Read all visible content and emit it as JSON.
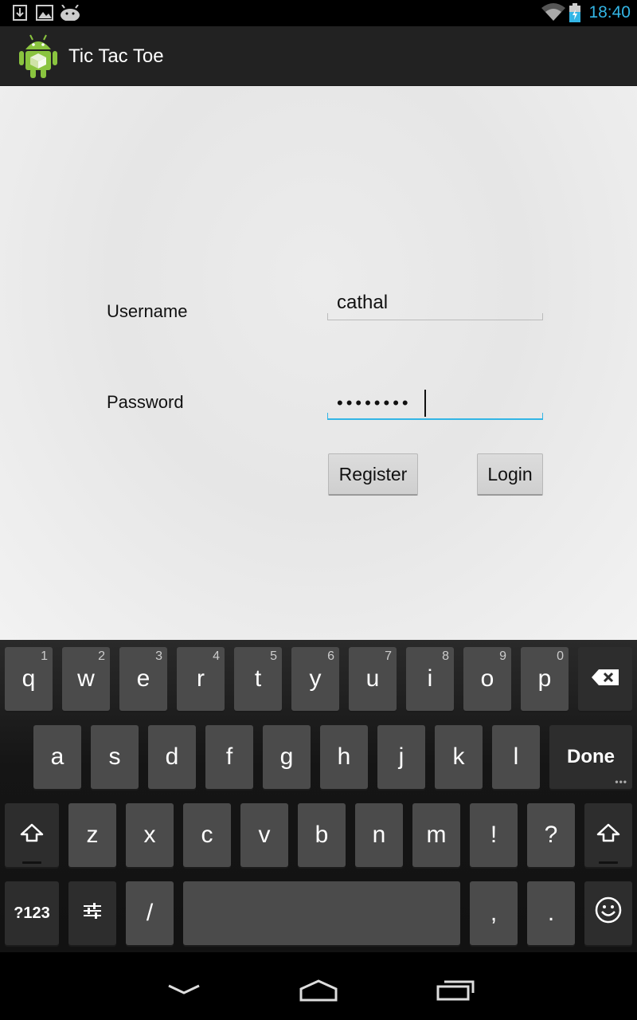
{
  "status_bar": {
    "time": "18:40",
    "left_icons": [
      "download-icon",
      "picture-icon",
      "android-debug-icon"
    ],
    "right_icons": [
      "wifi-icon",
      "battery-icon"
    ]
  },
  "action_bar": {
    "title": "Tic Tac Toe",
    "icon": "android-app-icon"
  },
  "form": {
    "username_label": "Username",
    "username_value": "cathal",
    "password_label": "Password",
    "password_masked": "••••••••",
    "register_label": "Register",
    "login_label": "Login"
  },
  "keyboard": {
    "row1": [
      {
        "label": "q",
        "hint": "1"
      },
      {
        "label": "w",
        "hint": "2"
      },
      {
        "label": "e",
        "hint": "3"
      },
      {
        "label": "r",
        "hint": "4"
      },
      {
        "label": "t",
        "hint": "5"
      },
      {
        "label": "y",
        "hint": "6"
      },
      {
        "label": "u",
        "hint": "7"
      },
      {
        "label": "i",
        "hint": "8"
      },
      {
        "label": "o",
        "hint": "9"
      },
      {
        "label": "p",
        "hint": "0"
      }
    ],
    "row2": [
      "a",
      "s",
      "d",
      "f",
      "g",
      "h",
      "j",
      "k",
      "l"
    ],
    "done_label": "Done",
    "row3": [
      "z",
      "x",
      "c",
      "v",
      "b",
      "n",
      "m",
      "!",
      "?"
    ],
    "symbols_label": "?123",
    "slash_label": "/",
    "comma_label": ",",
    "period_label": ".",
    "icons": [
      "backspace-icon",
      "shift-icon",
      "settings-sliders-icon",
      "emoji-icon"
    ]
  },
  "nav_bar": {
    "icons": [
      "back-icon",
      "home-icon",
      "recent-apps-icon"
    ]
  },
  "colors": {
    "accent": "#33b5e5",
    "action_bar": "#222222",
    "content_bg": "#e8e8e8",
    "key_bg": "#4b4b4b",
    "key_dark_bg": "#2d2d2d"
  }
}
